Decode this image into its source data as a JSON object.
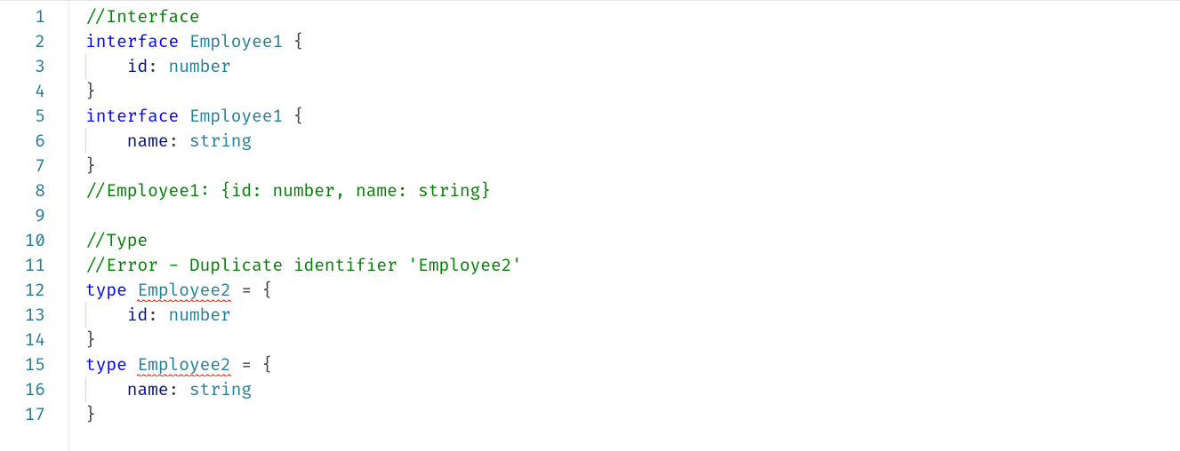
{
  "editor": {
    "language": "typescript",
    "colors": {
      "comment": "#008000",
      "keyword": "#0000ff",
      "type": "#267f99",
      "property": "#001080",
      "error_underline": "#e51400",
      "line_number": "#237893"
    },
    "lines": [
      {
        "n": 1,
        "indent": 0,
        "tokens": [
          {
            "t": "//Interface",
            "c": "comment"
          }
        ]
      },
      {
        "n": 2,
        "indent": 0,
        "tokens": [
          {
            "t": "interface",
            "c": "keyword"
          },
          {
            "t": " ",
            "c": "punct"
          },
          {
            "t": "Employee1",
            "c": "type"
          },
          {
            "t": " {",
            "c": "punct"
          }
        ]
      },
      {
        "n": 3,
        "indent": 1,
        "tokens": [
          {
            "t": "id",
            "c": "prop"
          },
          {
            "t": ": ",
            "c": "punct"
          },
          {
            "t": "number",
            "c": "type"
          }
        ]
      },
      {
        "n": 4,
        "indent": 0,
        "tokens": [
          {
            "t": "}",
            "c": "punct"
          }
        ]
      },
      {
        "n": 5,
        "indent": 0,
        "tokens": [
          {
            "t": "interface",
            "c": "keyword"
          },
          {
            "t": " ",
            "c": "punct"
          },
          {
            "t": "Employee1",
            "c": "type"
          },
          {
            "t": " {",
            "c": "punct"
          }
        ]
      },
      {
        "n": 6,
        "indent": 1,
        "tokens": [
          {
            "t": "name",
            "c": "prop"
          },
          {
            "t": ": ",
            "c": "punct"
          },
          {
            "t": "string",
            "c": "type"
          }
        ]
      },
      {
        "n": 7,
        "indent": 0,
        "tokens": [
          {
            "t": "}",
            "c": "punct"
          }
        ]
      },
      {
        "n": 8,
        "indent": 0,
        "tokens": [
          {
            "t": "//Employee1: {id: number, name: string}",
            "c": "comment"
          }
        ]
      },
      {
        "n": 9,
        "indent": 0,
        "tokens": []
      },
      {
        "n": 10,
        "indent": 0,
        "tokens": [
          {
            "t": "//Type",
            "c": "comment"
          }
        ]
      },
      {
        "n": 11,
        "indent": 0,
        "tokens": [
          {
            "t": "//Error - Duplicate identifier 'Employee2'",
            "c": "comment"
          }
        ]
      },
      {
        "n": 12,
        "indent": 0,
        "tokens": [
          {
            "t": "type",
            "c": "keyword"
          },
          {
            "t": " ",
            "c": "punct"
          },
          {
            "t": "Employee2",
            "c": "type",
            "err": true
          },
          {
            "t": " = {",
            "c": "punct"
          }
        ]
      },
      {
        "n": 13,
        "indent": 1,
        "tokens": [
          {
            "t": "id",
            "c": "prop"
          },
          {
            "t": ": ",
            "c": "punct"
          },
          {
            "t": "number",
            "c": "type"
          }
        ]
      },
      {
        "n": 14,
        "indent": 0,
        "tokens": [
          {
            "t": "}",
            "c": "punct"
          }
        ]
      },
      {
        "n": 15,
        "indent": 0,
        "tokens": [
          {
            "t": "type",
            "c": "keyword"
          },
          {
            "t": " ",
            "c": "punct"
          },
          {
            "t": "Employee2",
            "c": "type",
            "err": true
          },
          {
            "t": " = {",
            "c": "punct"
          }
        ]
      },
      {
        "n": 16,
        "indent": 1,
        "tokens": [
          {
            "t": "name",
            "c": "prop"
          },
          {
            "t": ": ",
            "c": "punct"
          },
          {
            "t": "string",
            "c": "type"
          }
        ]
      },
      {
        "n": 17,
        "indent": 0,
        "tokens": [
          {
            "t": "}",
            "c": "punct"
          }
        ]
      }
    ]
  }
}
